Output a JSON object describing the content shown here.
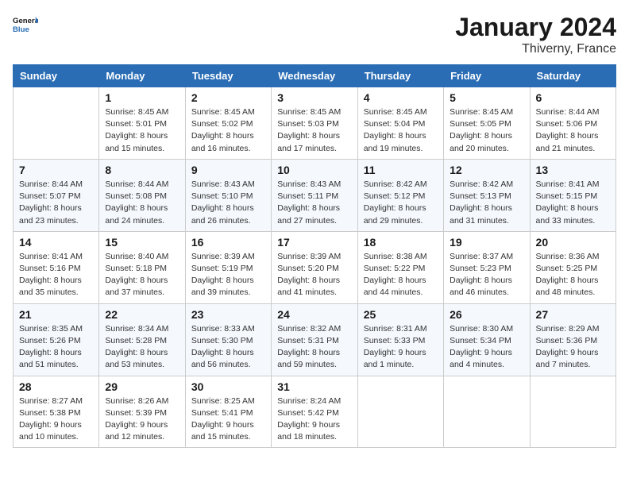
{
  "header": {
    "logo_line1": "General",
    "logo_line2": "Blue",
    "month_title": "January 2024",
    "location": "Thiverny, France"
  },
  "days_of_week": [
    "Sunday",
    "Monday",
    "Tuesday",
    "Wednesday",
    "Thursday",
    "Friday",
    "Saturday"
  ],
  "weeks": [
    [
      {
        "day": "",
        "sunrise": "",
        "sunset": "",
        "daylight": ""
      },
      {
        "day": "1",
        "sunrise": "Sunrise: 8:45 AM",
        "sunset": "Sunset: 5:01 PM",
        "daylight": "Daylight: 8 hours and 15 minutes."
      },
      {
        "day": "2",
        "sunrise": "Sunrise: 8:45 AM",
        "sunset": "Sunset: 5:02 PM",
        "daylight": "Daylight: 8 hours and 16 minutes."
      },
      {
        "day": "3",
        "sunrise": "Sunrise: 8:45 AM",
        "sunset": "Sunset: 5:03 PM",
        "daylight": "Daylight: 8 hours and 17 minutes."
      },
      {
        "day": "4",
        "sunrise": "Sunrise: 8:45 AM",
        "sunset": "Sunset: 5:04 PM",
        "daylight": "Daylight: 8 hours and 19 minutes."
      },
      {
        "day": "5",
        "sunrise": "Sunrise: 8:45 AM",
        "sunset": "Sunset: 5:05 PM",
        "daylight": "Daylight: 8 hours and 20 minutes."
      },
      {
        "day": "6",
        "sunrise": "Sunrise: 8:44 AM",
        "sunset": "Sunset: 5:06 PM",
        "daylight": "Daylight: 8 hours and 21 minutes."
      }
    ],
    [
      {
        "day": "7",
        "sunrise": "Sunrise: 8:44 AM",
        "sunset": "Sunset: 5:07 PM",
        "daylight": "Daylight: 8 hours and 23 minutes."
      },
      {
        "day": "8",
        "sunrise": "Sunrise: 8:44 AM",
        "sunset": "Sunset: 5:08 PM",
        "daylight": "Daylight: 8 hours and 24 minutes."
      },
      {
        "day": "9",
        "sunrise": "Sunrise: 8:43 AM",
        "sunset": "Sunset: 5:10 PM",
        "daylight": "Daylight: 8 hours and 26 minutes."
      },
      {
        "day": "10",
        "sunrise": "Sunrise: 8:43 AM",
        "sunset": "Sunset: 5:11 PM",
        "daylight": "Daylight: 8 hours and 27 minutes."
      },
      {
        "day": "11",
        "sunrise": "Sunrise: 8:42 AM",
        "sunset": "Sunset: 5:12 PM",
        "daylight": "Daylight: 8 hours and 29 minutes."
      },
      {
        "day": "12",
        "sunrise": "Sunrise: 8:42 AM",
        "sunset": "Sunset: 5:13 PM",
        "daylight": "Daylight: 8 hours and 31 minutes."
      },
      {
        "day": "13",
        "sunrise": "Sunrise: 8:41 AM",
        "sunset": "Sunset: 5:15 PM",
        "daylight": "Daylight: 8 hours and 33 minutes."
      }
    ],
    [
      {
        "day": "14",
        "sunrise": "Sunrise: 8:41 AM",
        "sunset": "Sunset: 5:16 PM",
        "daylight": "Daylight: 8 hours and 35 minutes."
      },
      {
        "day": "15",
        "sunrise": "Sunrise: 8:40 AM",
        "sunset": "Sunset: 5:18 PM",
        "daylight": "Daylight: 8 hours and 37 minutes."
      },
      {
        "day": "16",
        "sunrise": "Sunrise: 8:39 AM",
        "sunset": "Sunset: 5:19 PM",
        "daylight": "Daylight: 8 hours and 39 minutes."
      },
      {
        "day": "17",
        "sunrise": "Sunrise: 8:39 AM",
        "sunset": "Sunset: 5:20 PM",
        "daylight": "Daylight: 8 hours and 41 minutes."
      },
      {
        "day": "18",
        "sunrise": "Sunrise: 8:38 AM",
        "sunset": "Sunset: 5:22 PM",
        "daylight": "Daylight: 8 hours and 44 minutes."
      },
      {
        "day": "19",
        "sunrise": "Sunrise: 8:37 AM",
        "sunset": "Sunset: 5:23 PM",
        "daylight": "Daylight: 8 hours and 46 minutes."
      },
      {
        "day": "20",
        "sunrise": "Sunrise: 8:36 AM",
        "sunset": "Sunset: 5:25 PM",
        "daylight": "Daylight: 8 hours and 48 minutes."
      }
    ],
    [
      {
        "day": "21",
        "sunrise": "Sunrise: 8:35 AM",
        "sunset": "Sunset: 5:26 PM",
        "daylight": "Daylight: 8 hours and 51 minutes."
      },
      {
        "day": "22",
        "sunrise": "Sunrise: 8:34 AM",
        "sunset": "Sunset: 5:28 PM",
        "daylight": "Daylight: 8 hours and 53 minutes."
      },
      {
        "day": "23",
        "sunrise": "Sunrise: 8:33 AM",
        "sunset": "Sunset: 5:30 PM",
        "daylight": "Daylight: 8 hours and 56 minutes."
      },
      {
        "day": "24",
        "sunrise": "Sunrise: 8:32 AM",
        "sunset": "Sunset: 5:31 PM",
        "daylight": "Daylight: 8 hours and 59 minutes."
      },
      {
        "day": "25",
        "sunrise": "Sunrise: 8:31 AM",
        "sunset": "Sunset: 5:33 PM",
        "daylight": "Daylight: 9 hours and 1 minute."
      },
      {
        "day": "26",
        "sunrise": "Sunrise: 8:30 AM",
        "sunset": "Sunset: 5:34 PM",
        "daylight": "Daylight: 9 hours and 4 minutes."
      },
      {
        "day": "27",
        "sunrise": "Sunrise: 8:29 AM",
        "sunset": "Sunset: 5:36 PM",
        "daylight": "Daylight: 9 hours and 7 minutes."
      }
    ],
    [
      {
        "day": "28",
        "sunrise": "Sunrise: 8:27 AM",
        "sunset": "Sunset: 5:38 PM",
        "daylight": "Daylight: 9 hours and 10 minutes."
      },
      {
        "day": "29",
        "sunrise": "Sunrise: 8:26 AM",
        "sunset": "Sunset: 5:39 PM",
        "daylight": "Daylight: 9 hours and 12 minutes."
      },
      {
        "day": "30",
        "sunrise": "Sunrise: 8:25 AM",
        "sunset": "Sunset: 5:41 PM",
        "daylight": "Daylight: 9 hours and 15 minutes."
      },
      {
        "day": "31",
        "sunrise": "Sunrise: 8:24 AM",
        "sunset": "Sunset: 5:42 PM",
        "daylight": "Daylight: 9 hours and 18 minutes."
      },
      {
        "day": "",
        "sunrise": "",
        "sunset": "",
        "daylight": ""
      },
      {
        "day": "",
        "sunrise": "",
        "sunset": "",
        "daylight": ""
      },
      {
        "day": "",
        "sunrise": "",
        "sunset": "",
        "daylight": ""
      }
    ]
  ]
}
